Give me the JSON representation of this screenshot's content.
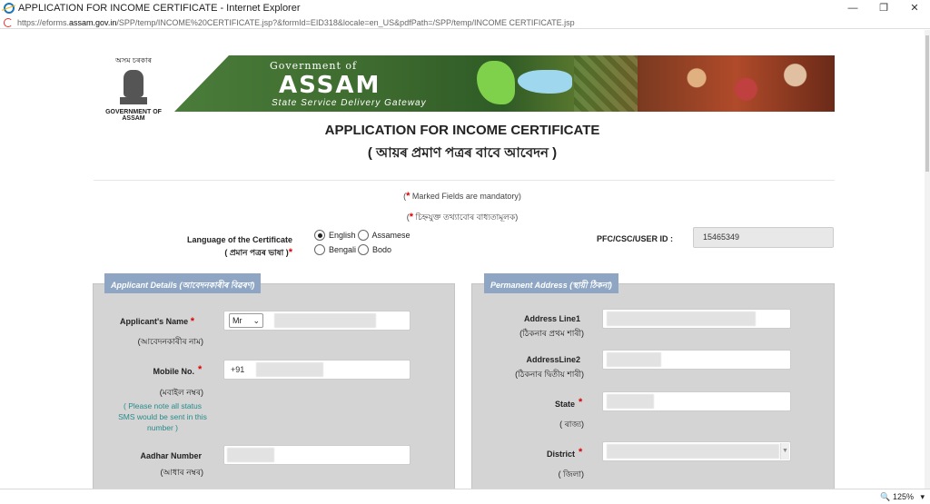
{
  "window": {
    "title": "APPLICATION FOR INCOME CERTIFICATE - Internet Explorer",
    "controls": [
      "—",
      "❐",
      "✕"
    ]
  },
  "address": {
    "prefix": "https://eforms.",
    "host": "assam.gov.in",
    "rest": "/SPP/temp/INCOME%20CERTIFICATE.jsp?&formId=EID318&locale=en_US&pdfPath=/SPP/temp/INCOME CERTIFICATE.jsp"
  },
  "header": {
    "emblem_top": "অসম চৰকাৰ",
    "emblem_bottom": "GOVERNMENT OF ASSAM",
    "banner_gov": "Government of",
    "banner_assam": "ASSAM",
    "banner_ssdg": "State Service Delivery Gateway"
  },
  "form": {
    "title_en": "APPLICATION FOR INCOME CERTIFICATE",
    "title_bn": "( আয়ৰ প্ৰমাণ পত্ৰৰ বাবে আবেদন )",
    "mandatory_en": "Marked Fields are mandatory)",
    "mandatory_bn": "চিহ্নযুক্ত তথ্যাবোৰ বাধ্যতামূলক)",
    "open_paren": "(",
    "star": "*",
    "language": {
      "label_en": "Language of the Certificate",
      "label_bn": "( প্ৰমান পত্ৰৰ ভাষা )",
      "options": [
        {
          "label": "English",
          "selected": true
        },
        {
          "label": "Assamese",
          "selected": false
        },
        {
          "label": "Bengali",
          "selected": false
        },
        {
          "label": "Bodo",
          "selected": false
        }
      ]
    },
    "pfc": {
      "label": "PFC/CSC/USER ID :",
      "value": "15465349"
    }
  },
  "applicant": {
    "tab": "Applicant Details (আবেদনকাৰীৰ বিৱৰণ)",
    "name_label": "Applicant's Name",
    "name_sub": "(আবেদনকাৰীৰ নাম)",
    "salutation": "Mr",
    "mobile_label": "Mobile No.",
    "mobile_sub": "(মবাইল নম্বৰ)",
    "mobile_prefix": "+91",
    "note": "( Please note all status SMS would be sent in this number )",
    "aadhar_label": "Aadhar Number",
    "aadhar_sub": "(আধাৰ নম্বৰ)"
  },
  "address_panel": {
    "tab": "Permanent Address (স্থায়ী ঠিকনা)",
    "line1_label": "Address Line1",
    "line1_sub": "(ঠিকনাৰ প্ৰথম শাৰী)",
    "line2_label": "AddressLine2",
    "line2_sub": "(ঠিকনাৰ দ্বিতীয় শাৰী)",
    "state_label": "State",
    "state_sub": "( ৰাজ্য)",
    "district_label": "District",
    "district_sub": "( জিলা)"
  },
  "status": {
    "zoom": "125%"
  }
}
